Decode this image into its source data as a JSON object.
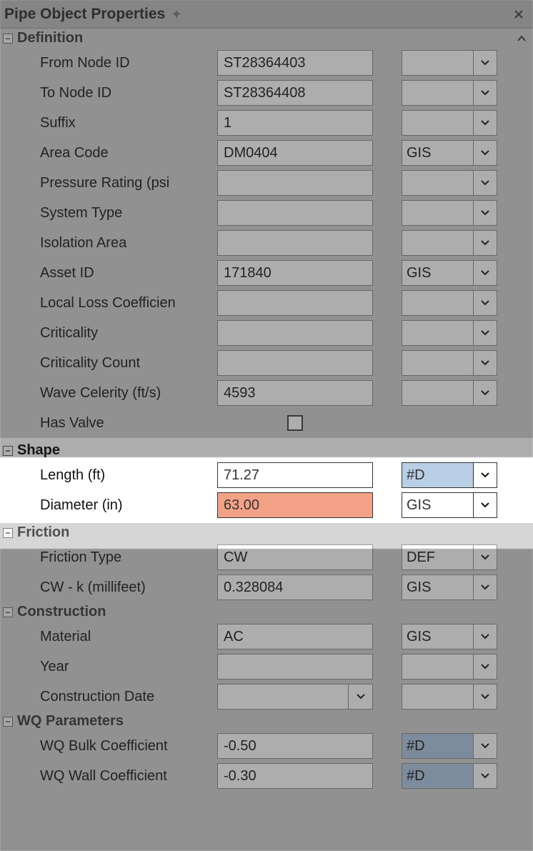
{
  "titlebar": {
    "title": "Pipe Object Properties"
  },
  "sections": {
    "definition": {
      "header": "Definition",
      "from_node_id": {
        "label": "From Node ID",
        "value": "ST28364403",
        "src": ""
      },
      "to_node_id": {
        "label": "To Node ID",
        "value": "ST28364408",
        "src": ""
      },
      "suffix": {
        "label": "Suffix",
        "value": "1",
        "src": ""
      },
      "area_code": {
        "label": "Area Code",
        "value": "DM0404",
        "src": "GIS"
      },
      "pressure_rating": {
        "label": "Pressure Rating (psi",
        "value": "",
        "src": ""
      },
      "system_type": {
        "label": "System Type",
        "value": "",
        "src": ""
      },
      "isolation_area": {
        "label": "Isolation Area",
        "value": "",
        "src": ""
      },
      "asset_id": {
        "label": "Asset ID",
        "value": "171840",
        "src": "GIS"
      },
      "local_loss": {
        "label": "Local Loss Coefficien",
        "value": "",
        "src": ""
      },
      "criticality": {
        "label": "Criticality",
        "value": "",
        "src": ""
      },
      "criticality_count": {
        "label": "Criticality Count",
        "value": "",
        "src": ""
      },
      "wave_celerity": {
        "label": "Wave Celerity (ft/s)",
        "value": "4593",
        "src": ""
      },
      "has_valve": {
        "label": "Has Valve"
      }
    },
    "shape": {
      "header": "Shape",
      "length": {
        "label": "Length (ft)",
        "value": "71.27",
        "src": "#D"
      },
      "diameter": {
        "label": "Diameter (in)",
        "value": "63.00",
        "src": "GIS"
      }
    },
    "friction": {
      "header": "Friction",
      "friction_type": {
        "label": "Friction Type",
        "value": "CW",
        "src": "DEF"
      },
      "cw_k": {
        "label": "CW - k (millifeet)",
        "value": "0.328084",
        "src": "GIS"
      }
    },
    "construction": {
      "header": "Construction",
      "material": {
        "label": "Material",
        "value": "AC",
        "src": "GIS"
      },
      "year": {
        "label": "Year",
        "value": "",
        "src": ""
      },
      "construction_date": {
        "label": "Construction Date",
        "value": "",
        "src": ""
      }
    },
    "wq": {
      "header": "WQ Parameters",
      "bulk": {
        "label": "WQ Bulk Coefficient",
        "value": "-0.50",
        "src": "#D"
      },
      "wall": {
        "label": "WQ Wall Coefficient",
        "value": "-0.30",
        "src": "#D"
      }
    }
  }
}
